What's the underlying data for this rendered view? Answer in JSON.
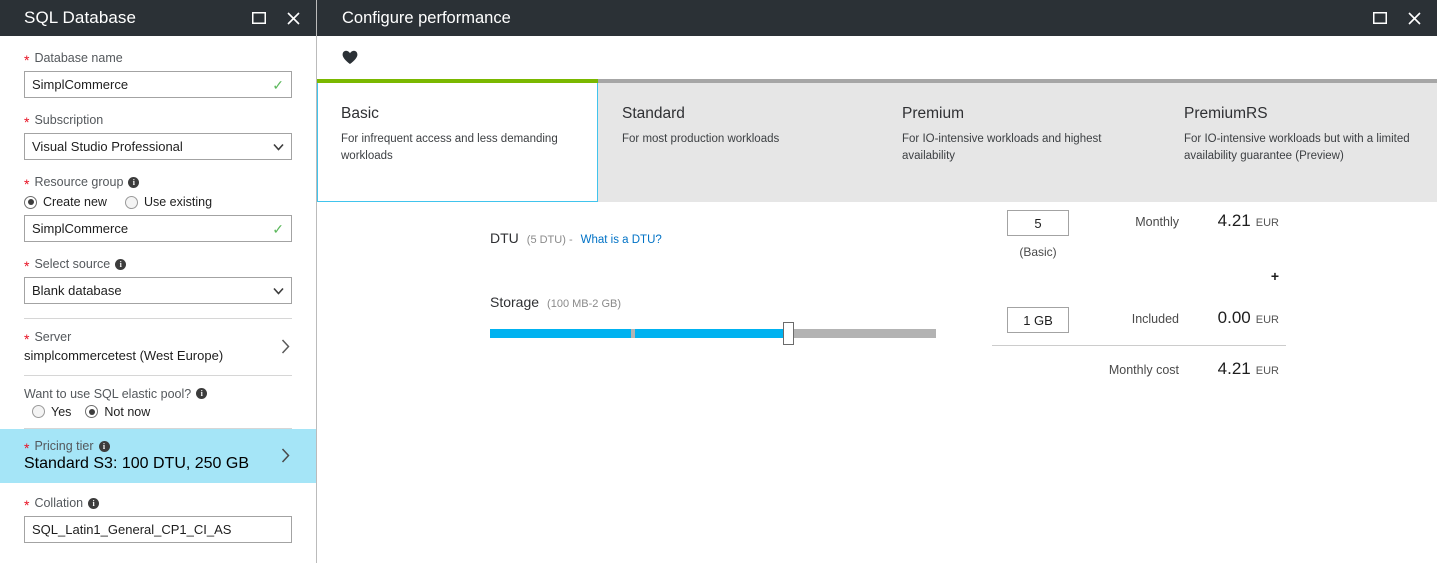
{
  "left_blade": {
    "title": "SQL Database",
    "window_controls": [
      {
        "name": "maximize",
        "glyph": "maximize-icon"
      },
      {
        "name": "close",
        "glyph": "close-icon"
      }
    ],
    "database_name": {
      "label": "Database name",
      "required": true,
      "value": "SimplCommerce",
      "placeholder": "Database name",
      "valid": true,
      "check_glyph": "✓"
    },
    "subscription": {
      "label": "Subscription",
      "required": true,
      "value": "Visual Studio Professional",
      "options": [
        "Visual Studio Professional"
      ]
    },
    "resource_group": {
      "label": "Resource group",
      "required": true,
      "has_info": true,
      "radios": [
        {
          "label": "Create new",
          "selected": true
        },
        {
          "label": "Use existing",
          "selected": false
        }
      ],
      "value": "SimplCommerce",
      "placeholder": "Resource group",
      "valid": true,
      "check_glyph": "✓"
    },
    "select_source": {
      "label": "Select source",
      "required": true,
      "has_info": true,
      "value": "Blank database",
      "options": [
        "Blank database"
      ]
    },
    "server": {
      "label": "Server",
      "required": true,
      "value": "simplcommercetest (West Europe)"
    },
    "elastic_pool": {
      "label": "Want to use SQL elastic pool?",
      "has_info": true,
      "radios": [
        {
          "label": "Yes",
          "selected": false
        },
        {
          "label": "Not now",
          "selected": true
        }
      ]
    },
    "pricing_tier": {
      "label": "Pricing tier",
      "required": true,
      "has_info": true,
      "value": "Standard S3: 100 DTU, 250 GB",
      "highlight_color": "#a5e5f7",
      "selected": true
    },
    "collation": {
      "label": "Collation",
      "required": true,
      "has_info": true,
      "value": "SQL_Latin1_General_CP1_CI_AS",
      "placeholder": "Collation"
    }
  },
  "right_blade": {
    "title": "Configure performance",
    "window_controls": [
      {
        "name": "maximize",
        "glyph": "maximize-icon"
      },
      {
        "name": "close",
        "glyph": "close-icon"
      }
    ],
    "favorite_icon": "heart-icon",
    "tabs": [
      {
        "name": "Basic",
        "desc": "For infrequent access and less demanding workloads",
        "selected": true
      },
      {
        "name": "Standard",
        "desc": "For most production workloads",
        "selected": false
      },
      {
        "name": "Premium",
        "desc": "For IO-intensive workloads and highest availability",
        "selected": false
      },
      {
        "name": "PremiumRS",
        "desc": "For IO-intensive workloads but with a limited availability guarantee (Preview)",
        "selected": false
      }
    ],
    "dtu": {
      "title": "DTU",
      "range": "(5 DTU) -",
      "link": "What is a DTU?",
      "input_value": "5",
      "tier_note": "(Basic)",
      "billing_label": "Monthly",
      "amount": "4.21",
      "currency": "EUR"
    },
    "plus_symbol": "+",
    "storage": {
      "title": "Storage",
      "range": "(100 MB-2 GB)",
      "input_value": "1 GB",
      "billing_label": "Included",
      "amount": "0.00",
      "currency": "EUR",
      "slider": {
        "min": 0,
        "max": 100,
        "value": 66,
        "fill_color": "#00b2f0",
        "track_color": "#b3b3b3"
      }
    },
    "total": {
      "label": "Monthly cost",
      "amount": "4.21",
      "currency": "EUR"
    }
  },
  "colors": {
    "header_bg": "#2b3136",
    "accent_green": "#7ab800",
    "accent_cyan": "#41c4ed",
    "link_blue": "#0072c6",
    "required_red": "#e81123",
    "valid_green": "#5cb85c",
    "highlight_blue": "#a5e5f7"
  }
}
